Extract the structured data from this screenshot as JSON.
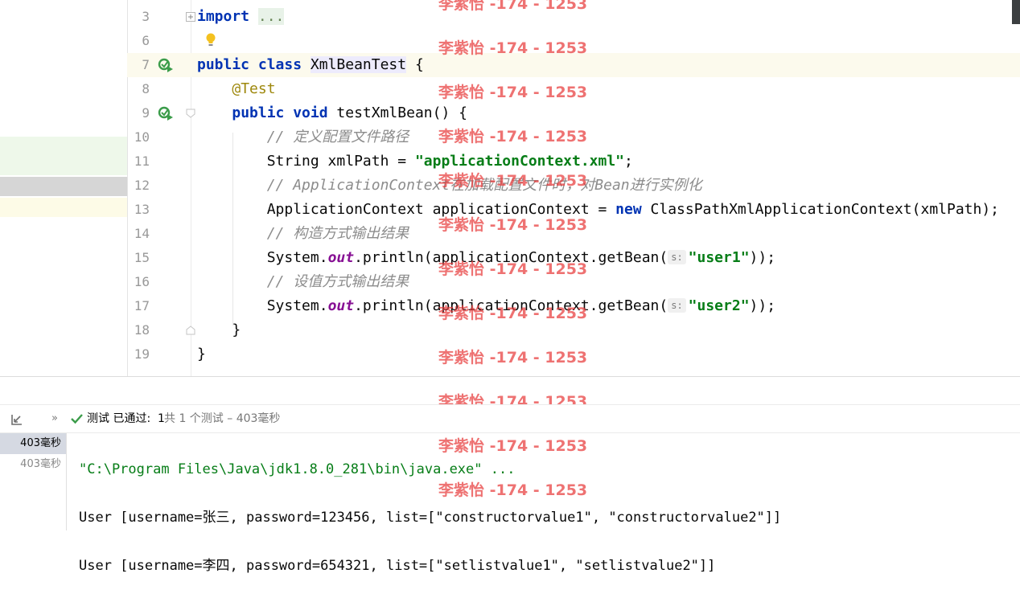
{
  "editor": {
    "lines": [
      {
        "num": "3",
        "parts": [
          [
            "kw",
            "import"
          ],
          [
            "t",
            " "
          ],
          [
            "fold",
            "..."
          ]
        ]
      },
      {
        "num": "6",
        "parts": []
      },
      {
        "num": "7",
        "parts": [
          [
            "kw",
            "public class "
          ],
          [
            "sel",
            "XmlBeanTest"
          ],
          [
            "t",
            " {"
          ]
        ]
      },
      {
        "num": "8",
        "parts": [
          [
            "t",
            "    "
          ],
          [
            "ann",
            "@Test"
          ]
        ]
      },
      {
        "num": "9",
        "parts": [
          [
            "t",
            "    "
          ],
          [
            "kw",
            "public void "
          ],
          [
            "t",
            "testXmlBean() {"
          ]
        ]
      },
      {
        "num": "10",
        "parts": [
          [
            "t",
            "        "
          ],
          [
            "cmt",
            "// 定义配置文件路径"
          ]
        ]
      },
      {
        "num": "11",
        "parts": [
          [
            "t",
            "        String xmlPath = "
          ],
          [
            "str",
            "\"applicationContext.xml\""
          ],
          [
            "t",
            ";"
          ]
        ]
      },
      {
        "num": "12",
        "parts": [
          [
            "t",
            "        "
          ],
          [
            "cmt",
            "// ApplicationContext在加载配置文件时，对Bean进行实例化"
          ]
        ]
      },
      {
        "num": "13",
        "parts": [
          [
            "t",
            "        ApplicationContext applicationContext = "
          ],
          [
            "kw",
            "new "
          ],
          [
            "t",
            "ClassPathXmlApplicationContext(xmlPath);"
          ]
        ]
      },
      {
        "num": "14",
        "parts": [
          [
            "t",
            "        "
          ],
          [
            "cmt",
            "// 构造方式输出结果"
          ]
        ]
      },
      {
        "num": "15",
        "parts": [
          [
            "t",
            "        System."
          ],
          [
            "stat",
            "out"
          ],
          [
            "t",
            ".println(applicationContext.getBean("
          ],
          [
            "hint",
            "s:"
          ],
          [
            "str",
            "\"user1\""
          ],
          [
            "t",
            "));"
          ]
        ]
      },
      {
        "num": "16",
        "parts": [
          [
            "t",
            "        "
          ],
          [
            "cmt",
            "// 设值方式输出结果"
          ]
        ]
      },
      {
        "num": "17",
        "parts": [
          [
            "t",
            "        System."
          ],
          [
            "stat",
            "out"
          ],
          [
            "t",
            ".println(applicationContext.getBean("
          ],
          [
            "hint",
            "s:"
          ],
          [
            "str",
            "\"user2\""
          ],
          [
            "t",
            "));"
          ]
        ]
      },
      {
        "num": "18",
        "parts": [
          [
            "t",
            "    }"
          ]
        ]
      },
      {
        "num": "19",
        "parts": [
          [
            "t",
            "}"
          ]
        ]
      }
    ]
  },
  "watermark": "李紫怡 -174 - 1253",
  "test_bar": {
    "status_label": "测试 已通过:",
    "passed_count": "1",
    "summary": "共 1 个测试 – 403毫秒"
  },
  "test_tree": {
    "items": [
      "403毫秒",
      "403毫秒"
    ]
  },
  "console": {
    "lines": [
      "\"C:\\Program Files\\Java\\jdk1.8.0_281\\bin\\java.exe\" ...",
      "User [username=张三, password=123456, list=[\"constructorvalue1\", \"constructorvalue2\"]]",
      "User [username=李四, password=654321, list=[\"setlistvalue1\", \"setlistvalue2\"]]"
    ]
  },
  "icons": {
    "run": "run-test-icon",
    "bulb": "intention-bulb-icon",
    "fold": "fold-icon",
    "pass": "check-icon",
    "expand": "expand-all-icon",
    "more": "chevron-double-right-icon"
  },
  "colors": {
    "keyword": "#0033b3",
    "string": "#067d17",
    "comment": "#8c8c8c",
    "annotation": "#9e880d",
    "static_field": "#871094",
    "pass_green": "#3b9c4a",
    "watermark": "#e83c3c"
  }
}
